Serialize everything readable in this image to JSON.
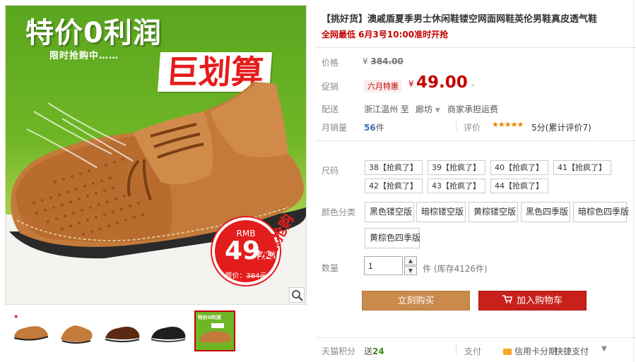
{
  "gallery": {
    "promo_title": "特价0利润",
    "promo_sub": "限时抢购中……",
    "promo_big": "巨划算",
    "badge": {
      "rmb": "RMB",
      "price": "49",
      "unit": "包邮",
      "orig_label": "原价：",
      "orig_value": "384元"
    },
    "rush_text": "赶紧抢购",
    "thumbnails": [
      "thumb-1",
      "thumb-2",
      "thumb-3",
      "thumb-4",
      "thumb-5"
    ],
    "thumb5_label": "特价0利润"
  },
  "product": {
    "title": "【挑好货】澳戚盾夏季男士休闲鞋镂空网面网鞋英伦男鞋真皮透气鞋",
    "subtitle": "全网最低 6月3号10:00准时开抢"
  },
  "labels": {
    "price": "价格",
    "promo": "促销",
    "ship": "配送",
    "sales": "月销量",
    "size": "尺码",
    "color": "颜色分类",
    "quantity": "数量",
    "points": "天猫积分"
  },
  "price": {
    "currency": "¥",
    "original": "384.00",
    "promo_tag": "六月特惠",
    "sale": "49.00"
  },
  "shipping": {
    "from": "浙江温州",
    "to_prefix": "至",
    "to": "廊坊",
    "note": "商家承担运费"
  },
  "sales": {
    "count": "56",
    "unit": "件",
    "eval_label": "评价",
    "stars": "★★★★★",
    "eval_text": "5分(累计评价7)"
  },
  "sizes": [
    "38【抢疯了】",
    "39【抢疯了】",
    "40【抢疯了】",
    "41【抢疯了】",
    "42【抢疯了】",
    "43【抢疯了】",
    "44【抢疯了】"
  ],
  "colors": [
    "黑色镂空版",
    "暗棕镂空版",
    "黄棕镂空版",
    "黑色四季版",
    "暗棕色四季版",
    "黄棕色四季版"
  ],
  "quantity": {
    "value": "1",
    "stock": "件 (库存4126件)"
  },
  "buttons": {
    "buy": "立刻购买",
    "cart": "加入购物车"
  },
  "footer": {
    "points_prefix": "送",
    "points_value": "24",
    "pay_label": "支付",
    "pay_card": "信用卡分期",
    "pay_quick": "快捷支付"
  },
  "colors_theme": {
    "accent_red": "#c40000",
    "buy_brown": "#c98a4c",
    "cart_red": "#c8201b",
    "link_blue": "#3c6db7"
  }
}
